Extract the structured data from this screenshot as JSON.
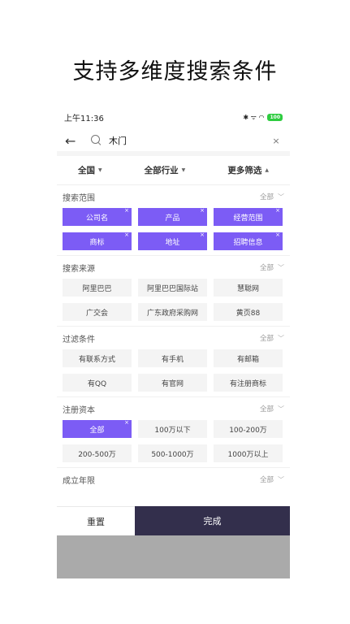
{
  "hero_title": "支持多维度搜索条件",
  "status": {
    "time": "上午11:36",
    "icons": "✱ ᯤ ◠",
    "battery": "100"
  },
  "search": {
    "value": "木门",
    "clear": "×"
  },
  "tabs": [
    {
      "label": "全国",
      "caret": "▼"
    },
    {
      "label": "全部行业",
      "caret": "▼"
    },
    {
      "label": "更多筛选",
      "caret": "▲"
    }
  ],
  "sections": {
    "range": {
      "title": "搜索范围",
      "all": "全部",
      "chips": [
        {
          "label": "公司名",
          "selected": true
        },
        {
          "label": "产品",
          "selected": true
        },
        {
          "label": "经营范围",
          "selected": true
        },
        {
          "label": "商标",
          "selected": true
        },
        {
          "label": "地址",
          "selected": true
        },
        {
          "label": "招聘信息",
          "selected": true
        }
      ]
    },
    "source": {
      "title": "搜索来源",
      "all": "全部",
      "chips": [
        {
          "label": "阿里巴巴",
          "selected": false
        },
        {
          "label": "阿里巴巴国际站",
          "selected": false
        },
        {
          "label": "慧聪网",
          "selected": false
        },
        {
          "label": "广交会",
          "selected": false
        },
        {
          "label": "广东政府采购网",
          "selected": false
        },
        {
          "label": "黄页88",
          "selected": false
        }
      ]
    },
    "filter": {
      "title": "过滤条件",
      "all": "全部",
      "chips": [
        {
          "label": "有联系方式",
          "selected": false
        },
        {
          "label": "有手机",
          "selected": false
        },
        {
          "label": "有邮箱",
          "selected": false
        },
        {
          "label": "有QQ",
          "selected": false
        },
        {
          "label": "有官网",
          "selected": false
        },
        {
          "label": "有注册商标",
          "selected": false
        }
      ]
    },
    "capital": {
      "title": "注册资本",
      "all": "全部",
      "chips": [
        {
          "label": "全部",
          "selected": true
        },
        {
          "label": "100万以下",
          "selected": false
        },
        {
          "label": "100-200万",
          "selected": false
        },
        {
          "label": "200-500万",
          "selected": false
        },
        {
          "label": "500-1000万",
          "selected": false
        },
        {
          "label": "1000万以上",
          "selected": false
        }
      ]
    },
    "years": {
      "title": "成立年限",
      "all": "全部"
    }
  },
  "buttons": {
    "reset": "重置",
    "done": "完成"
  },
  "colors": {
    "accent": "#7c5cf5",
    "done_bg": "#332f4c",
    "overlay": "#aaaaaa"
  }
}
